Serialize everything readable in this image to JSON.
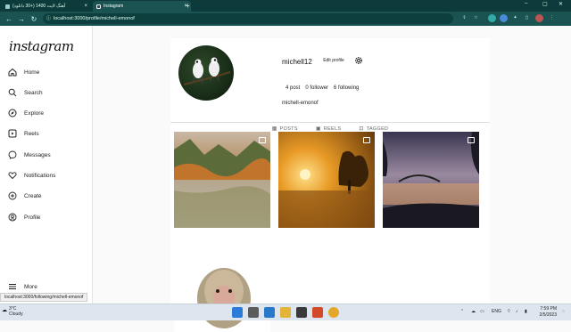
{
  "browser": {
    "tabs": [
      {
        "label": "آهنگ لایت 1400 (+30 دانلود)",
        "close": "×"
      },
      {
        "label": "Instagram",
        "close": "×"
      }
    ],
    "new_tab": "+",
    "window_controls": {
      "minimize": "–",
      "maximize": "▢",
      "close": "✕"
    },
    "url": "localhost:3000/profile/michell-emonof",
    "theme_color": "#1b5353"
  },
  "sidebar": {
    "logo": "instagram",
    "items": [
      {
        "label": "Home",
        "icon": "home-icon"
      },
      {
        "label": "Search",
        "icon": "search-icon"
      },
      {
        "label": "Explore",
        "icon": "compass-icon"
      },
      {
        "label": "Reels",
        "icon": "reels-icon"
      },
      {
        "label": "Messages",
        "icon": "messenger-icon"
      },
      {
        "label": "Notifications",
        "icon": "heart-icon"
      },
      {
        "label": "Create",
        "icon": "plus-circle-icon"
      },
      {
        "label": "Profile",
        "icon": "profile-icon"
      }
    ],
    "more": "More"
  },
  "profile": {
    "username": "michell12",
    "edit_button": "Edit profile",
    "stats": {
      "posts": "4 post",
      "followers": "0 follower",
      "following": "6 following"
    },
    "full_name": "michell-emonof"
  },
  "tabs": {
    "posts": "POSTS",
    "reels": "REELS",
    "tagged": "TAGGED"
  },
  "posts": [
    {
      "subject": "autumn lake reflection"
    },
    {
      "subject": "golden sunset over water"
    },
    {
      "subject": "winter lake with bridge"
    },
    {
      "subject": "monkey portrait"
    }
  ],
  "status_bar_url": "localhost:3000/following/michell-emonof",
  "taskbar": {
    "weather_temp": "3°C",
    "weather_desc": "Cloudy",
    "lang": "ENG",
    "time": "7:59 PM",
    "date": "2/5/2023"
  }
}
